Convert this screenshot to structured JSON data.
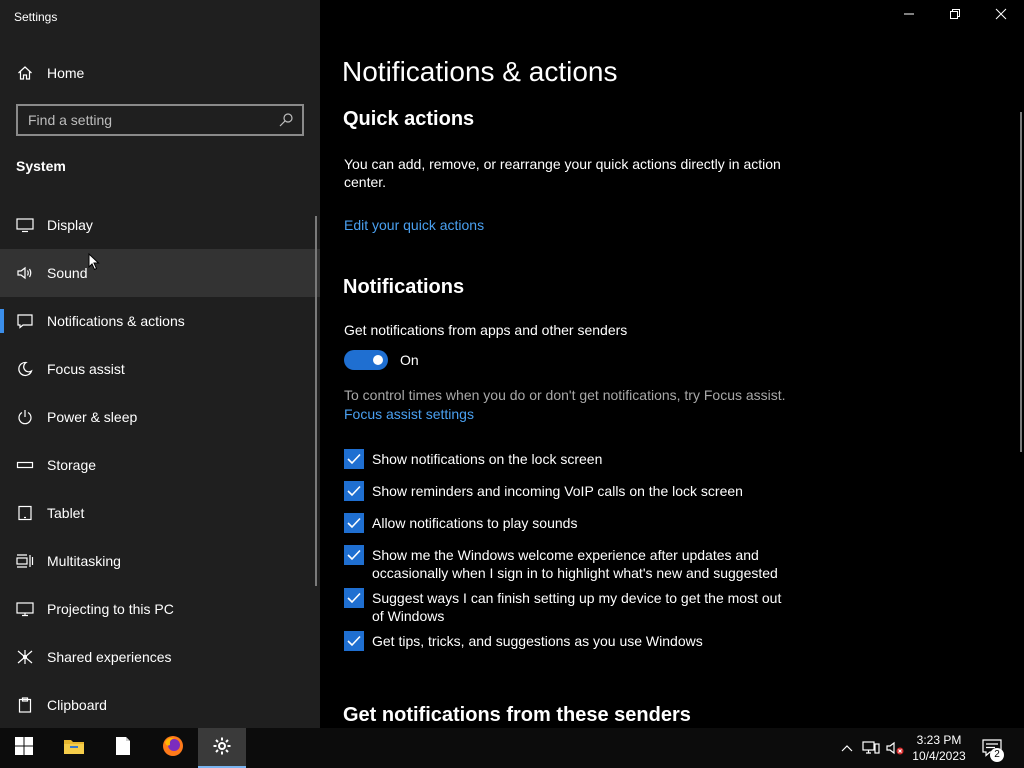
{
  "window": {
    "title": "Settings",
    "minimize_icon": "minimize-icon",
    "maximize_icon": "restore-icon",
    "close_icon": "close-icon"
  },
  "sidebar": {
    "home_label": "Home",
    "search": {
      "placeholder": "Find a setting"
    },
    "section_label": "System",
    "items": [
      {
        "label": "Display",
        "icon": "monitor-icon"
      },
      {
        "label": "Sound",
        "icon": "speaker-icon",
        "state": "hover"
      },
      {
        "label": "Notifications & actions",
        "icon": "notification-icon",
        "state": "selected"
      },
      {
        "label": "Focus assist",
        "icon": "moon-icon"
      },
      {
        "label": "Power & sleep",
        "icon": "power-icon"
      },
      {
        "label": "Storage",
        "icon": "storage-icon"
      },
      {
        "label": "Tablet",
        "icon": "tablet-icon"
      },
      {
        "label": "Multitasking",
        "icon": "multitasking-icon"
      },
      {
        "label": "Projecting to this PC",
        "icon": "projector-icon"
      },
      {
        "label": "Shared experiences",
        "icon": "share-icon"
      },
      {
        "label": "Clipboard",
        "icon": "clipboard-icon"
      }
    ]
  },
  "main": {
    "page_title": "Notifications & actions",
    "quick_actions": {
      "heading": "Quick actions",
      "description": "You can add, remove, or rearrange your quick actions directly in action center.",
      "link": "Edit your quick actions"
    },
    "notifications": {
      "heading": "Notifications",
      "toggle_caption": "Get notifications from apps and other senders",
      "toggle_state": "On",
      "focus_hint": "To control times when you do or don't get notifications, try Focus assist.",
      "focus_link": "Focus assist settings",
      "checkboxes": [
        {
          "label": "Show notifications on the lock screen",
          "checked": true
        },
        {
          "label": "Show reminders and incoming VoIP calls on the lock screen",
          "checked": true
        },
        {
          "label": "Allow notifications to play sounds",
          "checked": true
        },
        {
          "label": "Show me the Windows welcome experience after updates and occasionally when I sign in to highlight what's new and suggested",
          "checked": true
        },
        {
          "label": "Suggest ways I can finish setting up my device to get the most out of Windows",
          "checked": true
        },
        {
          "label": "Get tips, tricks, and suggestions as you use Windows",
          "checked": true
        }
      ]
    },
    "senders_heading": "Get notifications from these senders"
  },
  "taskbar": {
    "pinned": [
      {
        "name": "start-button",
        "icon": "windows-logo-icon"
      },
      {
        "name": "file-explorer-button",
        "icon": "folder-icon"
      },
      {
        "name": "notepad-button",
        "icon": "document-icon"
      },
      {
        "name": "firefox-button",
        "icon": "firefox-icon"
      },
      {
        "name": "settings-button",
        "icon": "gear-icon",
        "active": true
      }
    ],
    "tray": {
      "chevron_icon": "chevron-up-icon",
      "network_icon": "network-icon",
      "volume_icon": "volume-muted-icon",
      "time": "3:23 PM",
      "date": "10/4/2023",
      "action_center_icon": "action-center-icon",
      "notification_count": "2"
    }
  },
  "colors": {
    "accent": "#1f6fd1",
    "link": "#4aa0f0",
    "sidebar_bg": "#1f1f1f",
    "main_bg": "#000000",
    "taskbar_bg": "#0c0c0c"
  }
}
